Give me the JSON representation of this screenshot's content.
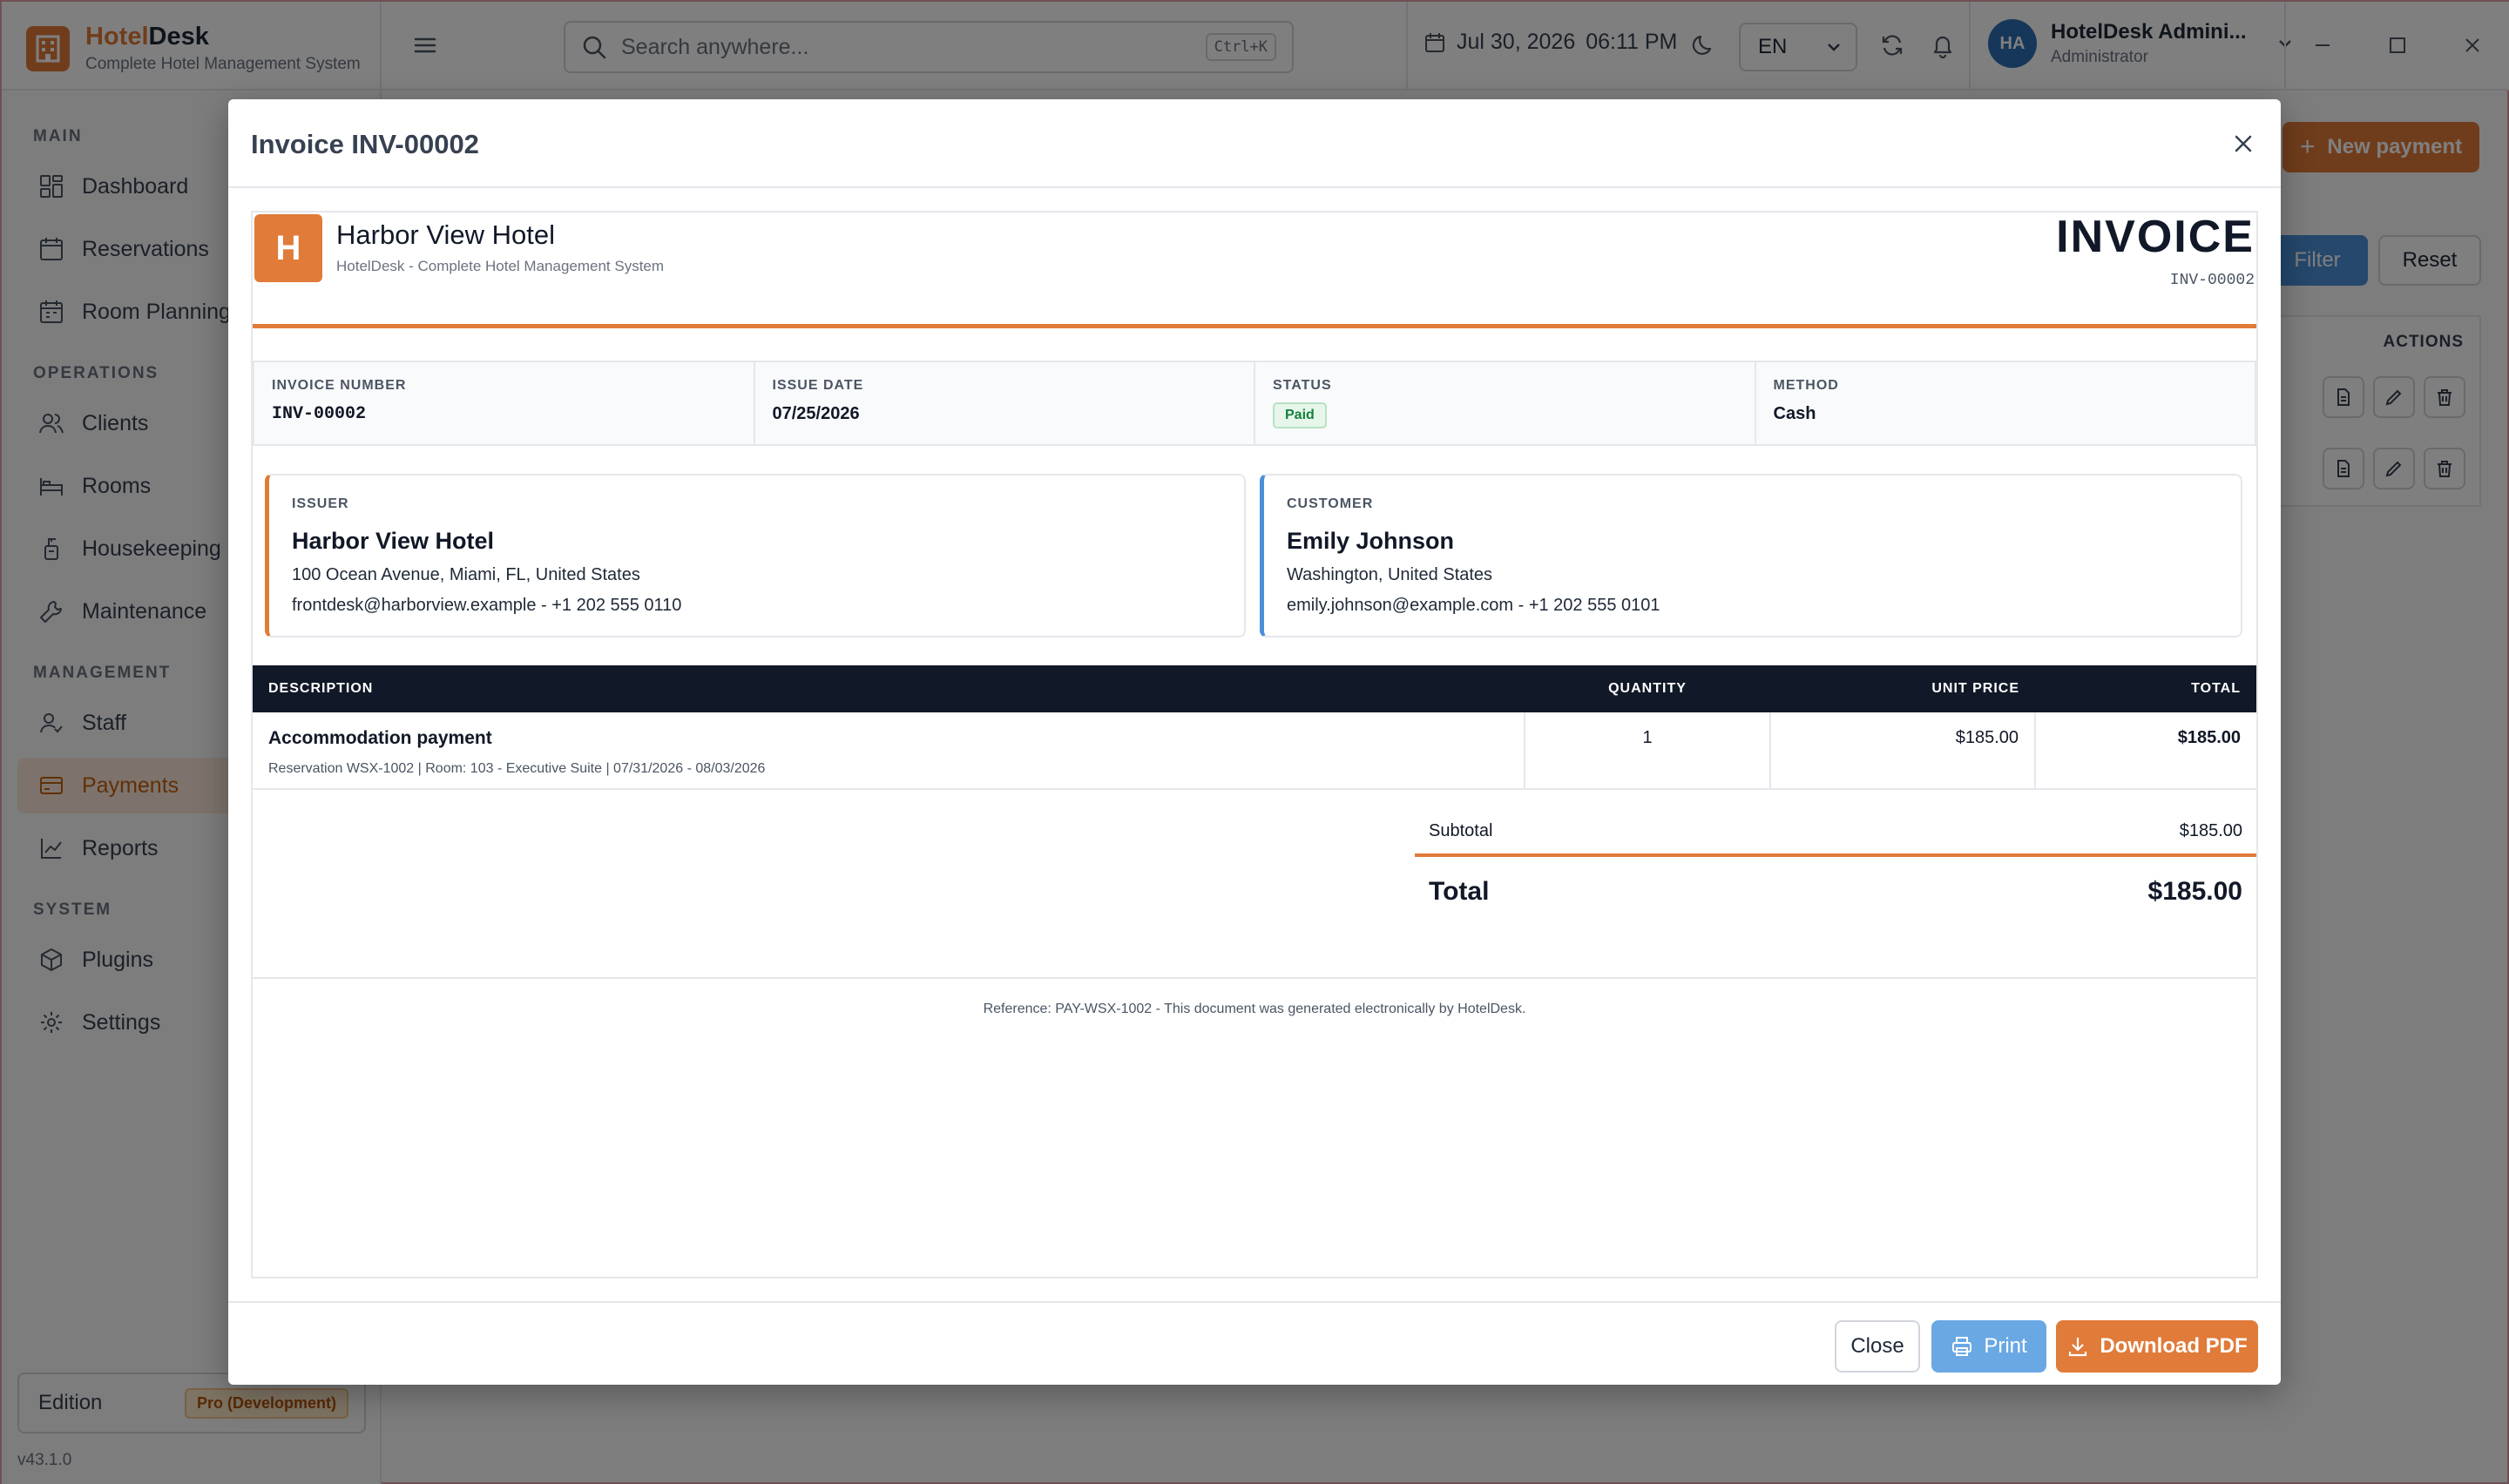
{
  "app": {
    "brand_prefix": "Hotel",
    "brand_suffix": "Desk",
    "brand_subtitle": "Complete Hotel Management System"
  },
  "topbar": {
    "search_placeholder": "Search anywhere...",
    "search_shortcut": "Ctrl+K",
    "date": "Jul 30, 2026",
    "time": "06:11 PM",
    "language": "EN",
    "user_initials": "HA",
    "user_name": "HotelDesk Admini...",
    "user_role": "Administrator"
  },
  "sidebar": {
    "sections": [
      {
        "title": "MAIN"
      },
      {
        "title": "OPERATIONS"
      },
      {
        "title": "MANAGEMENT"
      },
      {
        "title": "SYSTEM"
      }
    ],
    "items": [
      {
        "label": "Dashboard",
        "icon": "dashboard-icon"
      },
      {
        "label": "Reservations",
        "icon": "calendar-icon"
      },
      {
        "label": "Room Planning",
        "icon": "calendar-grid-icon"
      },
      {
        "label": "Clients",
        "icon": "users-icon"
      },
      {
        "label": "Rooms",
        "icon": "bed-icon"
      },
      {
        "label": "Housekeeping",
        "icon": "cleaning-icon"
      },
      {
        "label": "Maintenance",
        "icon": "wrench-icon"
      },
      {
        "label": "Staff",
        "icon": "staff-icon"
      },
      {
        "label": "Payments",
        "icon": "credit-card-icon",
        "active": true
      },
      {
        "label": "Reports",
        "icon": "chart-icon"
      },
      {
        "label": "Plugins",
        "icon": "cube-icon"
      },
      {
        "label": "Settings",
        "icon": "gear-icon"
      }
    ],
    "edition_label": "Edition",
    "edition_badge": "Pro (Development)",
    "version": "v43.1.0"
  },
  "background_page": {
    "new_payment_label": "New payment",
    "filter_label": "Filter",
    "reset_label": "Reset",
    "actions_header": "ACTIONS"
  },
  "modal": {
    "title": "Invoice INV-00002",
    "close_label": "Close",
    "print_label": "Print",
    "download_label": "Download PDF"
  },
  "invoice": {
    "logo_letter": "H",
    "hotel_name": "Harbor View Hotel",
    "hotel_subtitle": "HotelDesk - Complete Hotel Management System",
    "doc_title": "INVOICE",
    "number": "INV-00002",
    "meta": {
      "number_label": "INVOICE NUMBER",
      "number_value": "INV-00002",
      "date_label": "ISSUE DATE",
      "date_value": "07/25/2026",
      "status_label": "STATUS",
      "status_value": "Paid",
      "method_label": "METHOD",
      "method_value": "Cash"
    },
    "issuer": {
      "label": "ISSUER",
      "name": "Harbor View Hotel",
      "address": "100 Ocean Avenue, Miami, FL, United States",
      "contact": "frontdesk@harborview.example - +1 202 555 0110"
    },
    "customer": {
      "label": "CUSTOMER",
      "name": "Emily Johnson",
      "address": "Washington, United States",
      "contact": "emily.johnson@example.com - +1 202 555 0101"
    },
    "table": {
      "headers": {
        "description": "DESCRIPTION",
        "quantity": "QUANTITY",
        "unit_price": "UNIT PRICE",
        "total": "TOTAL"
      },
      "rows": [
        {
          "title": "Accommodation payment",
          "detail": "Reservation WSX-1002 | Room: 103 - Executive Suite | 07/31/2026 - 08/03/2026",
          "quantity": "1",
          "unit_price": "$185.00",
          "total": "$185.00"
        }
      ]
    },
    "subtotal_label": "Subtotal",
    "subtotal_value": "$185.00",
    "total_label": "Total",
    "total_value": "$185.00",
    "footer_note": "Reference: PAY-WSX-1002 - This document was generated electronically by HotelDesk."
  },
  "colors": {
    "accent": "#e07b39",
    "blue": "#4a90d9",
    "dark": "#111827",
    "paid_green": "#15803d"
  }
}
